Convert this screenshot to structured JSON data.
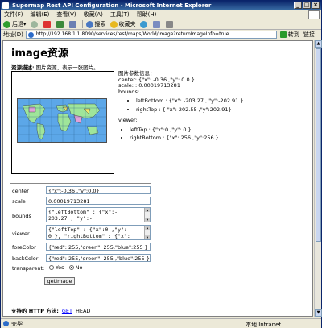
{
  "window": {
    "title": "Supermap Rest API Configuration - Microsoft Internet Explorer"
  },
  "menu": [
    "文件(F)",
    "编辑(E)",
    "查看(V)",
    "收藏(A)",
    "工具(T)",
    "帮助(H)"
  ],
  "toolbar": {
    "back": "后退",
    "search": "搜索",
    "favorites": "收藏夹"
  },
  "addressbar": {
    "label": "地址(D)",
    "url": "http://192.168.1.1:8090/services/rest/maps/World/image?returnImageInfo=true",
    "go": "转到",
    "links": "链接"
  },
  "page": {
    "heading": "image资源",
    "desc_label": "资源描述:",
    "desc_text": "图片资源，表示一张图片。",
    "info_title": "图片参数信息：",
    "center_line": "center: {\"x\": -0.36 ,\"y\": 0.0 }",
    "scale_line": "scale: : 0.00019713281",
    "bounds_label": "bounds:",
    "bounds_left": "leftBottom : {\"x\": -203.27 , \"y\":-202.91 }",
    "bounds_right": "rightTop : { \"x\": 202.55 ,\"y\":202.91}",
    "viewer_label": "viewer:",
    "viewer_left": "leftTop : {\"x\":0 ,\"y\": 0 }",
    "viewer_right": "rightBottom : {\"x\": 256 ,\"y\":256 }"
  },
  "form": {
    "center_label": "center",
    "center_value": "{\"x\":-0.36 ,\"y\":0.0}",
    "scale_label": "scale",
    "scale_value": "0.00019713281",
    "bounds_label": "bounds",
    "bounds_value": "{\"leftBottom\" : {\"x\":-\n203.27 , \"y\":-",
    "viewer_label": "viewer",
    "viewer_value": "{\"leftTop\" : {\"x\":0 ,\"y\":\n0 }, \"rightBottom\" : {\"x\":",
    "forecolor_label": "foreColor",
    "forecolor_value": "{\"red\": 255,\"green\": 255,\"blue\":255 }",
    "backcolor_label": "backColor",
    "backcolor_value": "{\"red\": 255,\"green\": 255 ,\"blue\":255 }",
    "transparent_label": "transparent:",
    "yes": "Yes",
    "no": "No",
    "button": "getImage"
  },
  "support": {
    "label": "支持的 HTTP 方法:",
    "get": "GET",
    "head": "HEAD"
  },
  "statusbar": {
    "left": "完毕",
    "zone": "本地 Intranet"
  }
}
